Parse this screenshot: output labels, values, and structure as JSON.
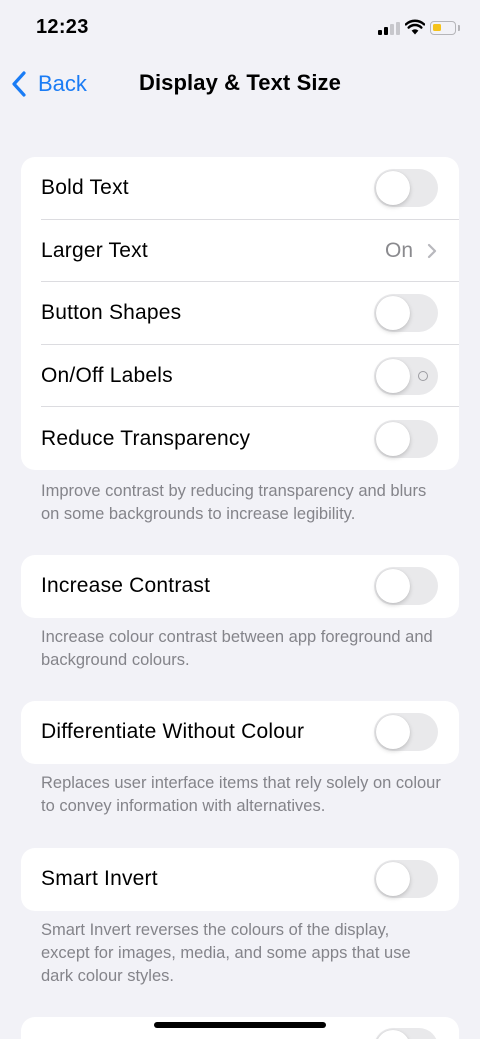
{
  "status_bar": {
    "time": "12:23"
  },
  "nav": {
    "back_label": "Back",
    "title": "Display & Text Size"
  },
  "group1": {
    "rows": [
      {
        "label": "Bold Text",
        "toggle": "off"
      },
      {
        "label": "Larger Text",
        "value": "On"
      },
      {
        "label": "Button Shapes",
        "toggle": "off"
      },
      {
        "label": "On/Off Labels",
        "toggle": "off"
      },
      {
        "label": "Reduce Transparency",
        "toggle": "off"
      }
    ],
    "footer": "Improve contrast by reducing transparency and blurs on some backgrounds to increase legibility."
  },
  "group2": {
    "label": "Increase Contrast",
    "toggle": "off",
    "footer": "Increase colour contrast between app foreground and background colours."
  },
  "group3": {
    "label": "Differentiate Without Colour",
    "toggle": "off",
    "footer": "Replaces user interface items that rely solely on colour to convey information with alternatives."
  },
  "group4": {
    "label": "Smart Invert",
    "toggle": "off",
    "footer": "Smart Invert reverses the colours of the display, except for images, media, and some apps that use dark colour styles."
  },
  "colors": {
    "accent": "#1a7cf5",
    "toggle_off": "#e9e9eb",
    "background": "#f2f2f7",
    "battery": "#f4c21b"
  }
}
